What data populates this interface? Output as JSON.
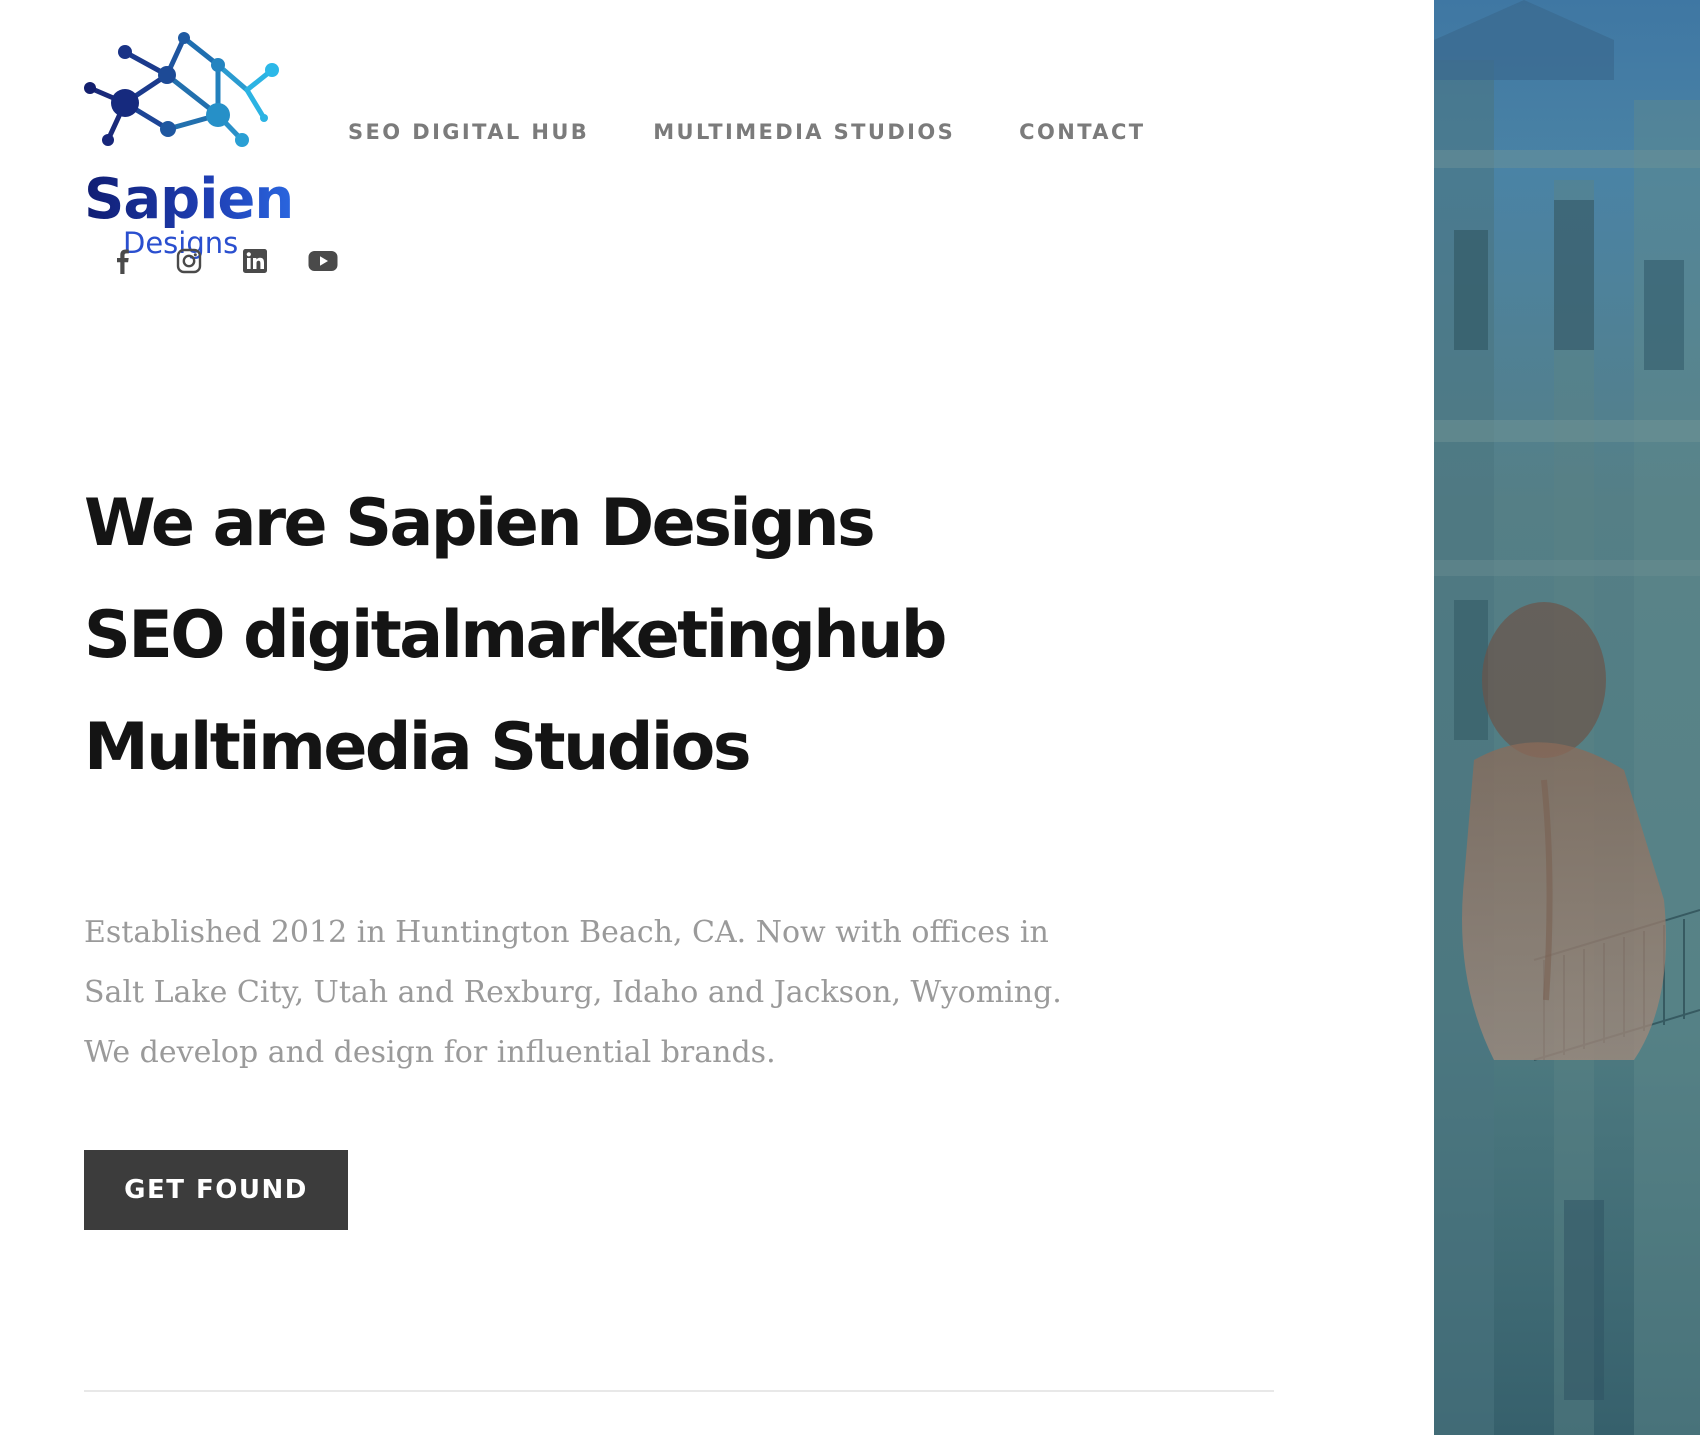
{
  "brand": {
    "name": "Sapien",
    "sub": "Designs"
  },
  "nav": {
    "items": [
      {
        "label": "SEO DIGITAL HUB"
      },
      {
        "label": "MULTIMEDIA STUDIOS"
      },
      {
        "label": "CONTACT"
      }
    ]
  },
  "social": {
    "icons": [
      "facebook-icon",
      "instagram-icon",
      "linkedin-icon",
      "youtube-icon"
    ]
  },
  "hero": {
    "headline": [
      "We are Sapien Designs",
      "SEO digitalmarketinghub",
      "Multimedia Studios"
    ],
    "intro": [
      "Established 2012 in Huntington Beach, CA. Now with offices in",
      "Salt Lake City, Utah and Rexburg, Idaho and Jackson, Wyoming.",
      "We develop and design for influential brands."
    ],
    "cta_label": "GET FOUND"
  },
  "colors": {
    "logo_dark": "#101d72",
    "logo_light": "#29b6e8",
    "nav_text": "#7b7b7b",
    "headline": "#141414",
    "intro_text": "#9a9a9a",
    "cta_bg": "#3c3c3c",
    "photo_tint": "#4a7a80"
  }
}
